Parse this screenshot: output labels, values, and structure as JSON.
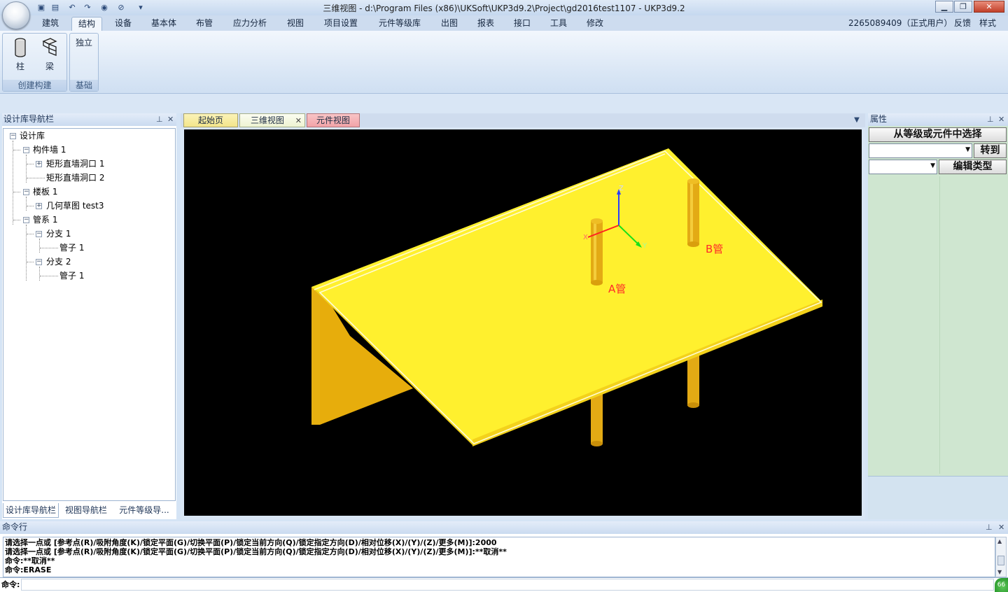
{
  "window": {
    "title": "三维视图 - d:\\Program Files (x86)\\UKSoft\\UKP3d9.2\\Project\\gd2016test1107 - UKP3d9.2",
    "min_icon": "minimize-icon",
    "max_icon": "restore-icon",
    "close_icon": "close-icon"
  },
  "quick_access": [
    "save-icon",
    "save-as-icon",
    "undo-icon",
    "redo-icon",
    "eye-icon",
    "hide-icon",
    "dropdown-icon"
  ],
  "ribbon_tabs": [
    {
      "label": "建筑",
      "active": false
    },
    {
      "label": "结构",
      "active": true
    },
    {
      "label": "设备",
      "active": false
    },
    {
      "label": "基本体",
      "active": false
    },
    {
      "label": "布管",
      "active": false
    },
    {
      "label": "应力分析",
      "active": false
    },
    {
      "label": "视图",
      "active": false
    },
    {
      "label": "项目设置",
      "active": false
    },
    {
      "label": "元件等级库",
      "active": false
    },
    {
      "label": "出图",
      "active": false
    },
    {
      "label": "报表",
      "active": false
    },
    {
      "label": "接口",
      "active": false
    },
    {
      "label": "工具",
      "active": false
    },
    {
      "label": "修改",
      "active": false
    }
  ],
  "user": {
    "id": "2265089409（正式用户）",
    "feedback": "反馈",
    "style": "样式"
  },
  "ribbon_groups": {
    "create": {
      "label": "创建构建",
      "buttons": [
        {
          "label": "柱",
          "icon": "column-icon"
        },
        {
          "label": "梁",
          "icon": "beam-icon"
        }
      ]
    },
    "base": {
      "label": "基础",
      "buttons": [
        {
          "label": "独立"
        }
      ]
    }
  },
  "left_panel": {
    "title": "设计库导航栏",
    "pin_icon": "pin-icon",
    "close_icon": "close-icon",
    "tree": [
      {
        "label": "设计库",
        "level": 0,
        "toggle": "−"
      },
      {
        "label": "构件墙 1",
        "level": 1,
        "toggle": "−"
      },
      {
        "label": "矩形直墙洞口 1",
        "level": 2,
        "toggle": "+"
      },
      {
        "label": "矩形直墙洞口 2",
        "level": 2,
        "toggle": ""
      },
      {
        "label": "楼板 1",
        "level": 1,
        "toggle": "−"
      },
      {
        "label": "几何草图 test3",
        "level": 2,
        "toggle": "+"
      },
      {
        "label": "管系 1",
        "level": 1,
        "toggle": "−"
      },
      {
        "label": "分支 1",
        "level": 2,
        "toggle": "−"
      },
      {
        "label": "管子 1",
        "level": 3,
        "toggle": ""
      },
      {
        "label": "分支 2",
        "level": 2,
        "toggle": "−"
      },
      {
        "label": "管子 1",
        "level": 3,
        "toggle": ""
      }
    ],
    "bottom_tabs": [
      "设计库导航栏",
      "视图导航栏",
      "元件等级导..."
    ]
  },
  "doc_tabs": [
    {
      "label": "起始页",
      "active": false,
      "color": "#f3e58a"
    },
    {
      "label": "三维视图",
      "active": true,
      "color": "#f0f4d8"
    },
    {
      "label": "元件视图",
      "active": false,
      "color": "#f2a3a8"
    }
  ],
  "viewport": {
    "labels": {
      "a_pipe": "A管",
      "b_pipe": "B管"
    },
    "axes": {
      "x": "X",
      "y": "Y",
      "z": "Z"
    },
    "colors": {
      "slab": "#fff02e",
      "wall": "#e6b010",
      "pipe": "#e3aa14",
      "label": "#ff2a2a",
      "background": "#000000"
    }
  },
  "right_panel": {
    "title": "属性",
    "select_button": "从等级或元件中选择",
    "goto_button": "转到",
    "edit_type_button": "编辑类型"
  },
  "command": {
    "title": "命令行",
    "lines": [
      "请选择一点或 [参考点(R)/吸附角度(K)/锁定平面(G)/切换平面(P)/锁定当前方向(Q)/锁定指定方向(D)/相对位移(X)/(Y)/(Z)/更多(M)]:2000",
      "请选择一点或 [参考点(R)/吸附角度(K)/锁定平面(G)/切换平面(P)/锁定当前方向(Q)/锁定指定方向(D)/相对位移(X)/(Y)/(Z)/更多(M)]:**取消**",
      "命令:**取消**",
      "命令:ERASE"
    ],
    "prompt": "命令:",
    "badge": "66"
  }
}
